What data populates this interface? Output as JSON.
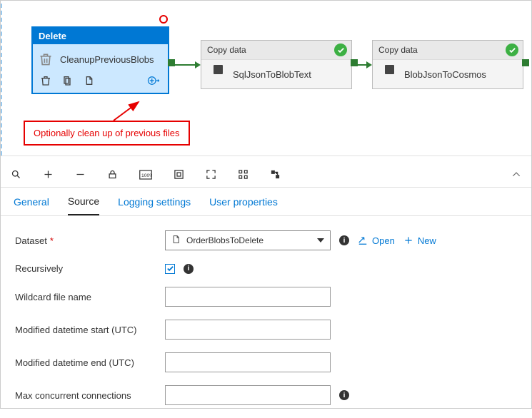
{
  "activities": {
    "delete": {
      "type_label": "Delete",
      "name": "CleanupPreviousBlobs"
    },
    "copy1": {
      "type_label": "Copy data",
      "name": "SqlJsonToBlobText"
    },
    "copy2": {
      "type_label": "Copy data",
      "name": "BlobJsonToCosmos"
    }
  },
  "callout": {
    "text": "Optionally clean up of previous files"
  },
  "tabs": {
    "general": "General",
    "source": "Source",
    "logging": "Logging settings",
    "user_props": "User properties"
  },
  "form": {
    "dataset": {
      "label": "Dataset",
      "value": "OrderBlobsToDelete",
      "open": "Open",
      "new": "New"
    },
    "recursively": {
      "label": "Recursively",
      "checked": true
    },
    "wildcard": {
      "label": "Wildcard file name",
      "value": ""
    },
    "mod_start": {
      "label": "Modified datetime start (UTC)",
      "value": ""
    },
    "mod_end": {
      "label": "Modified datetime end (UTC)",
      "value": ""
    },
    "max_conn": {
      "label": "Max concurrent connections",
      "value": ""
    }
  }
}
